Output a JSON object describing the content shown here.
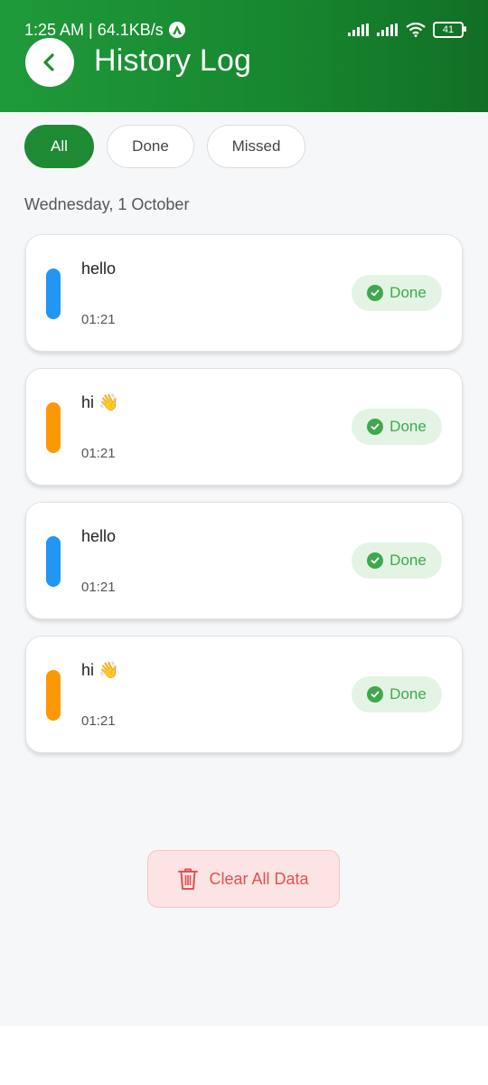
{
  "status_bar": {
    "time_speed": "1:25 AM | 64.1KB/s",
    "battery": "41"
  },
  "header": {
    "title": "History Log"
  },
  "filters": [
    {
      "label": "All",
      "active": true
    },
    {
      "label": "Done",
      "active": false
    },
    {
      "label": "Missed",
      "active": false
    }
  ],
  "date_heading": "Wednesday, 1 October",
  "entries": [
    {
      "title": "hello",
      "time": "01:21",
      "status": "Done",
      "color": "#2196f3"
    },
    {
      "title": "hi 👋",
      "time": "01:21",
      "status": "Done",
      "color": "#ff9800"
    },
    {
      "title": "hello",
      "time": "01:21",
      "status": "Done",
      "color": "#2196f3"
    },
    {
      "title": "hi 👋",
      "time": "01:21",
      "status": "Done",
      "color": "#ff9800"
    }
  ],
  "clear_button": {
    "label": "Clear All Data",
    "icon": "trash-icon"
  },
  "colors": {
    "header_green": "#1f9a3a",
    "done_green": "#3fa84c",
    "danger_red": "#e35050"
  }
}
